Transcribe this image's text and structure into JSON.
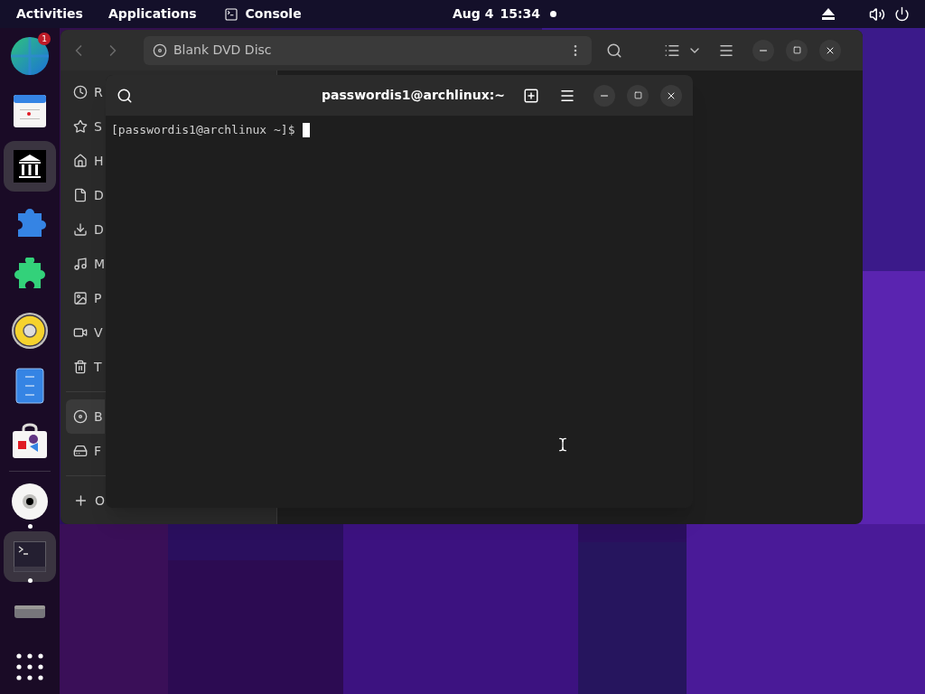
{
  "top_bar": {
    "activities": "Activities",
    "applications": "Applications",
    "app_menu": "Console",
    "date": "Aug 4",
    "time": "15:34"
  },
  "dock": {
    "items": [
      {
        "badge": "1",
        "running": false,
        "selected": false
      },
      {
        "running": false,
        "selected": false
      },
      {
        "running": false,
        "selected": true
      },
      {
        "running": false,
        "selected": false
      },
      {
        "running": false,
        "selected": false
      },
      {
        "running": false,
        "selected": false
      },
      {
        "running": false,
        "selected": false
      },
      {
        "running": false,
        "selected": false
      },
      {
        "running": true,
        "selected": false
      },
      {
        "running": true,
        "selected": true
      },
      {
        "running": false,
        "selected": false
      },
      {
        "running": false,
        "selected": false
      }
    ]
  },
  "files_window": {
    "location": "Blank DVD Disc",
    "sidebar": [
      [
        {
          "label": "R",
          "selected": false
        },
        {
          "label": "S",
          "selected": false
        },
        {
          "label": "H",
          "selected": false
        },
        {
          "label": "D",
          "selected": false
        },
        {
          "label": "D",
          "selected": false
        },
        {
          "label": "M",
          "selected": false
        },
        {
          "label": "P",
          "selected": false
        },
        {
          "label": "V",
          "selected": false
        },
        {
          "label": "T",
          "selected": false
        }
      ],
      [
        {
          "label": "B",
          "selected": true
        },
        {
          "label": "F",
          "selected": false
        }
      ],
      [
        {
          "label": "O",
          "selected": false
        }
      ]
    ]
  },
  "terminal": {
    "title": "passwordis1@archlinux:~",
    "prompt": "[passwordis1@archlinux ~]$"
  }
}
